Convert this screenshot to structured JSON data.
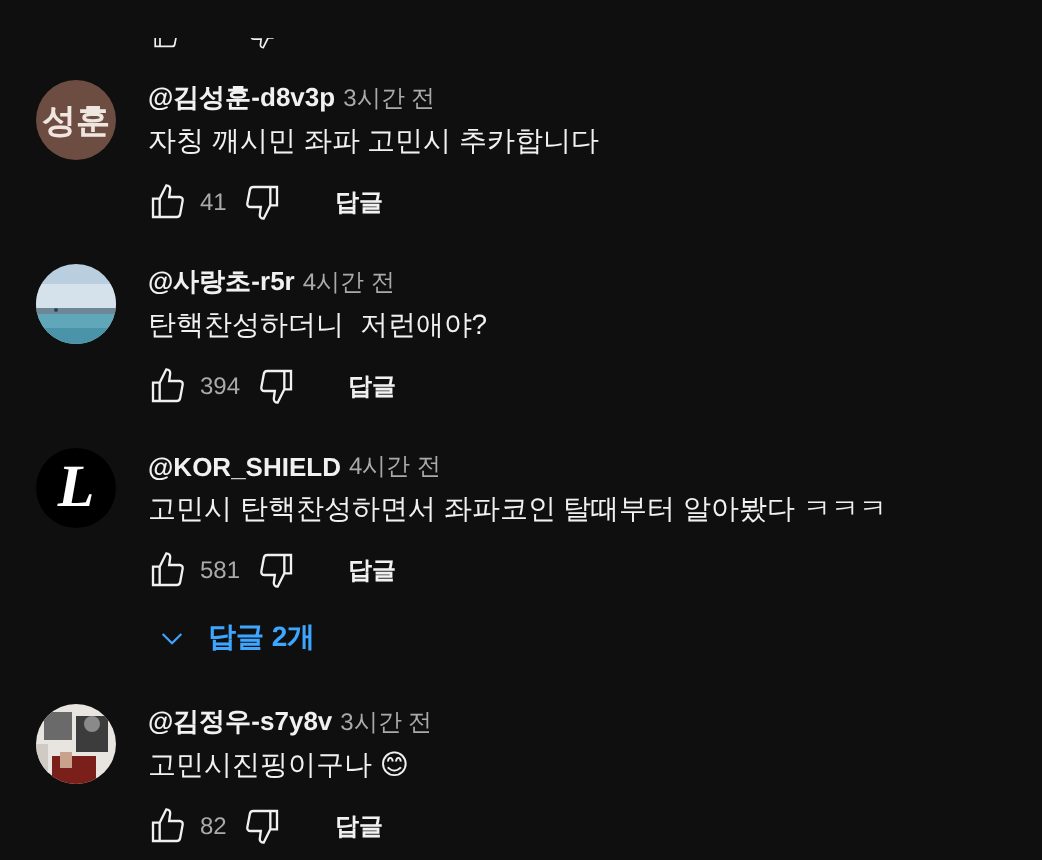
{
  "previous_comment": {
    "actions_cut_off": true
  },
  "comments": [
    {
      "avatar": {
        "kind": "initials",
        "text": "성훈",
        "color": "#6d4c41"
      },
      "author": "@김성훈-d8v3p",
      "time": "3시간 전",
      "text": "자칭 깨시민 좌파 고민시 추카합니다",
      "likes": "41",
      "reply_label": "답글"
    },
    {
      "author": "@사랑초-r5r",
      "time": "4시간 전",
      "text": "탄핵찬성하더니  저런애야?",
      "likes": "394",
      "reply_label": "답글"
    },
    {
      "avatar": {
        "kind": "letter",
        "text": "L"
      },
      "author": "@KOR_SHIELD",
      "time": "4시간 전",
      "text": "고민시 탄핵찬성하면서 좌파코인 탈때부터 알아봤다 ㅋㅋㅋ",
      "likes": "581",
      "reply_label": "답글",
      "replies_toggle": {
        "label": "답글 2개",
        "expanded": false
      }
    },
    {
      "author": "@김정우-s7y8v",
      "time": "3시간 전",
      "text": "고민시진핑이구나 😊",
      "likes": "82",
      "reply_label": "답글"
    }
  ]
}
